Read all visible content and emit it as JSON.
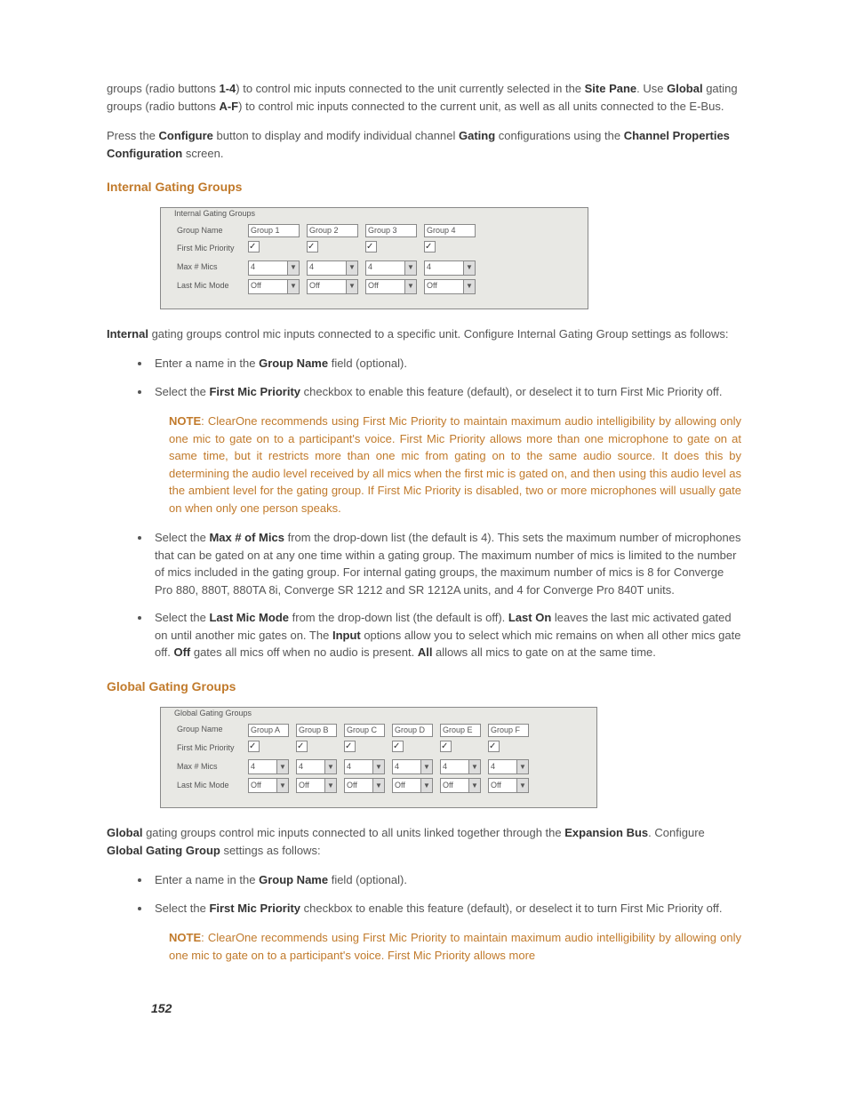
{
  "intro_para": {
    "t1": "groups (radio buttons ",
    "b1": "1-4",
    "t2": ") to control mic inputs connected to the unit currently selected in the ",
    "b2": "Site Pane",
    "t3": ". Use ",
    "b3": "Global",
    "t4": " gating groups (radio buttons ",
    "b4": "A-F",
    "t5": ") to control mic inputs connected to the current unit, as well as all units connected to the E-Bus."
  },
  "press_para": {
    "t1": "Press the ",
    "b1": "Configure",
    "t2": " button to display and modify individual channel ",
    "b2": "Gating",
    "t3": " configurations using the ",
    "b3": "Channel Properties Configuration",
    "t4": " screen."
  },
  "heading_internal": "Internal Gating Groups",
  "panel_internal": {
    "title": "Internal Gating Groups",
    "row_labels": [
      "Group Name",
      "First Mic Priority",
      "Max # Mics",
      "Last Mic Mode"
    ],
    "group_name": [
      "Group 1",
      "Group 2",
      "Group 3",
      "Group 4"
    ],
    "first_mic": [
      true,
      true,
      true,
      true
    ],
    "max_mics": [
      "4",
      "4",
      "4",
      "4"
    ],
    "last_mic": [
      "Off",
      "Off",
      "Off",
      "Off"
    ]
  },
  "internal_para": {
    "b1": "Internal",
    "t1": " gating groups control mic inputs connected to a specific unit. Configure Internal Gating Group settings as follows:"
  },
  "li_internal_1": {
    "t1": "Enter a name in the ",
    "b1": "Group Name",
    "t2": " field (optional)."
  },
  "li_internal_2": {
    "t1": "Select the ",
    "b1": "First Mic Priority",
    "t2": " checkbox to enable this feature (default), or deselect it to turn First Mic Priority off."
  },
  "note1": {
    "label": "NOTE",
    "text": ": ClearOne recommends using First Mic Priority to maintain maximum audio intelligibility by allowing only one mic to gate on to a participant's voice. First Mic Priority allows more than one microphone to gate on at same time, but it restricts more than one mic from gating on to the same audio source. It does this by determining the audio level received by all mics when the first mic is gated on, and then using this audio level as the ambient level for the gating group. If First Mic Priority is disabled, two or more microphones will usually gate on when only one person speaks."
  },
  "li_internal_3": {
    "t1": "Select the ",
    "b1": "Max # of Mics",
    "t2": " from the drop-down list (the default is 4). This sets the maximum number of microphones that can be gated on at any one time within a gating group. The maximum number of mics is limited to the number of mics included in the gating group. For internal gating groups, the maximum number of mics is 8 for Converge Pro 880, 880T, 880TA 8i, Converge SR 1212 and SR 1212A units, and 4 for Converge Pro 840T units."
  },
  "li_internal_4": {
    "t1": "Select the ",
    "b1": "Last Mic Mode",
    "t2": " from the drop-down list (the default is off). ",
    "b2": "Last On",
    "t3": " leaves the last mic activated gated on until another mic gates on. The ",
    "b3": "Input",
    "t4": " options allow you to select which mic remains on when all other mics gate off. ",
    "b4": "Off",
    "t5": " gates all mics off when no audio is present. ",
    "b5": "All",
    "t6": " allows all mics to gate on at the same time."
  },
  "heading_global": "Global Gating Groups",
  "panel_global": {
    "title": "Global Gating Groups",
    "row_labels": [
      "Group Name",
      "First Mic Priority",
      "Max # Mics",
      "Last Mic Mode"
    ],
    "group_name": [
      "Group A",
      "Group B",
      "Group C",
      "Group D",
      "Group E",
      "Group F"
    ],
    "first_mic": [
      true,
      true,
      true,
      true,
      true,
      true
    ],
    "max_mics": [
      "4",
      "4",
      "4",
      "4",
      "4",
      "4"
    ],
    "last_mic": [
      "Off",
      "Off",
      "Off",
      "Off",
      "Off",
      "Off"
    ]
  },
  "global_para": {
    "b1": "Global",
    "t1": " gating groups control mic inputs connected to all units linked together through the ",
    "b2": "Expansion Bus",
    "t2": ". Configure ",
    "b3": "Global Gating Group",
    "t3": " settings as follows:"
  },
  "li_global_1": {
    "t1": "Enter a name in the ",
    "b1": "Group Name",
    "t2": " field (optional)."
  },
  "li_global_2": {
    "t1": "Select the ",
    "b1": "First Mic Priority",
    "t2": " checkbox to enable this feature (default), or deselect it to turn First Mic Priority off."
  },
  "note2": {
    "label": "NOTE",
    "text": ": ClearOne recommends using First Mic Priority to maintain maximum audio intelligibility by allowing only one mic to gate on to a participant's voice. First Mic Priority allows more"
  },
  "page_number": "152"
}
